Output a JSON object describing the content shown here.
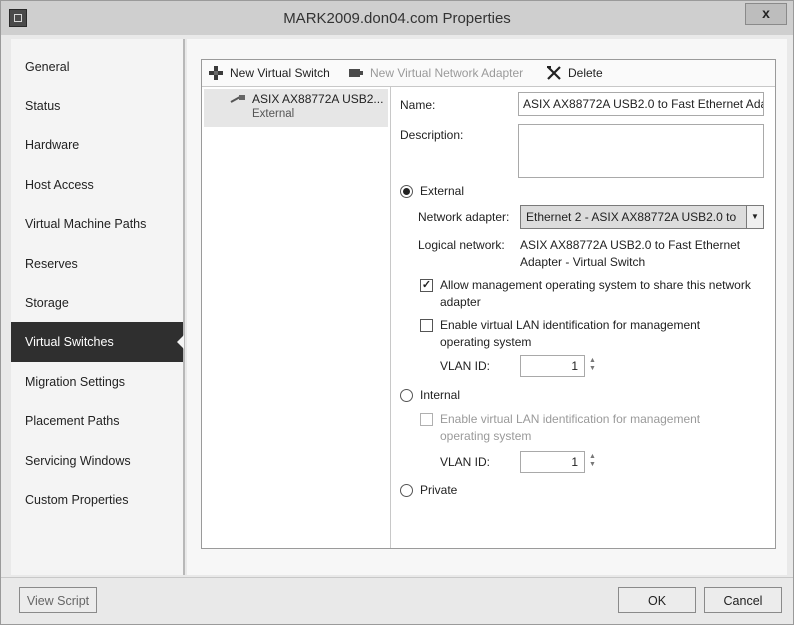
{
  "window": {
    "title": "MARK2009.don04.com Properties",
    "close_label": "x"
  },
  "sidebar": {
    "items": [
      {
        "label": "General"
      },
      {
        "label": "Status"
      },
      {
        "label": "Hardware"
      },
      {
        "label": "Host Access"
      },
      {
        "label": "Virtual Machine Paths"
      },
      {
        "label": "Reserves"
      },
      {
        "label": "Storage"
      },
      {
        "label": "Virtual Switches"
      },
      {
        "label": "Migration Settings"
      },
      {
        "label": "Placement Paths"
      },
      {
        "label": "Servicing Windows"
      },
      {
        "label": "Custom Properties"
      }
    ],
    "active_index": 7
  },
  "toolbar": {
    "new_switch": "New Virtual Switch",
    "new_adapter": "New Virtual Network Adapter",
    "delete": "Delete"
  },
  "switch_list": [
    {
      "name": "ASIX AX88772A USB2...",
      "type": "External"
    }
  ],
  "details": {
    "name_label": "Name:",
    "name_value": "ASIX AX88772A USB2.0 to Fast Ethernet Ada",
    "description_label": "Description:",
    "description_value": "",
    "external_label": "External",
    "network_adapter_label": "Network adapter:",
    "network_adapter_value": "Ethernet 2 - ASIX AX88772A USB2.0 to",
    "logical_network_label": "Logical network:",
    "logical_network_line1": "ASIX AX88772A USB2.0 to Fast Ethernet",
    "logical_network_line2": "Adapter - Virtual Switch",
    "allow_mgmt_line1": "Allow management operating system to share this network",
    "allow_mgmt_line2": "adapter",
    "allow_mgmt_checked": true,
    "enable_vlan_line1": "Enable virtual LAN identification for management",
    "enable_vlan_line2": "operating system",
    "enable_vlan_checked": false,
    "vlan_label": "VLAN ID:",
    "vlan_value": "1",
    "internal_label": "Internal",
    "internal_vlan_line1": "Enable virtual LAN identification for management",
    "internal_vlan_line2": "operating system",
    "internal_vlan_label": "VLAN ID:",
    "internal_vlan_value": "1",
    "private_label": "Private",
    "selected_type": "External"
  },
  "footer": {
    "view_script": "View Script",
    "ok": "OK",
    "cancel": "Cancel"
  },
  "icons": {
    "new_switch": "plus-network-icon",
    "new_adapter": "network-adapter-icon",
    "delete": "delete-x-icon",
    "switch_item": "network-cable-icon"
  }
}
